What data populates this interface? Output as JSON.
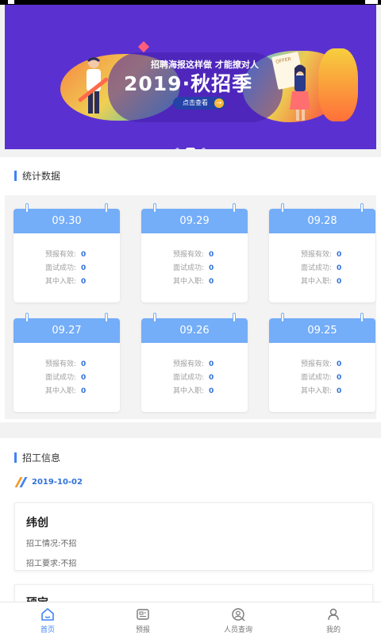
{
  "banner": {
    "slogan": "招聘海报这样做  才能撩对人",
    "title": "2019·秋招季",
    "cta_label": "点击查看",
    "paper_text": "OFFER",
    "dots": 3,
    "active_dot": 1
  },
  "stats": {
    "header": "统计数据",
    "labels": {
      "reported": "预报有效:",
      "interviewed": "面试成功:",
      "hired": "其中入职:"
    },
    "cards": [
      {
        "date": "09.30",
        "reported": "0",
        "interviewed": "0",
        "hired": "0"
      },
      {
        "date": "09.29",
        "reported": "0",
        "interviewed": "0",
        "hired": "0"
      },
      {
        "date": "09.28",
        "reported": "0",
        "interviewed": "0",
        "hired": "0"
      },
      {
        "date": "09.27",
        "reported": "0",
        "interviewed": "0",
        "hired": "0"
      },
      {
        "date": "09.26",
        "reported": "0",
        "interviewed": "0",
        "hired": "0"
      },
      {
        "date": "09.25",
        "reported": "0",
        "interviewed": "0",
        "hired": "0"
      }
    ]
  },
  "recruit": {
    "header": "招工信息",
    "date": "2019-10-02",
    "jobs": [
      {
        "company": "纬创",
        "status_label": "招工情况:",
        "status": "不招",
        "req_label": "招工要求:",
        "req": "不招"
      },
      {
        "company": "硕宝"
      }
    ]
  },
  "tabbar": {
    "items": [
      {
        "label": "首页",
        "icon": "home-icon",
        "active": true
      },
      {
        "label": "预报",
        "icon": "report-icon",
        "active": false
      },
      {
        "label": "人员查询",
        "icon": "person-search-icon",
        "active": false
      },
      {
        "label": "我的",
        "icon": "user-icon",
        "active": false
      }
    ],
    "active_color": "#3f83f5"
  },
  "colors": {
    "accent": "#3f83f5",
    "card_header": "#74adf8",
    "banner_bg": "#5a31d0",
    "value": "#3272d8"
  }
}
